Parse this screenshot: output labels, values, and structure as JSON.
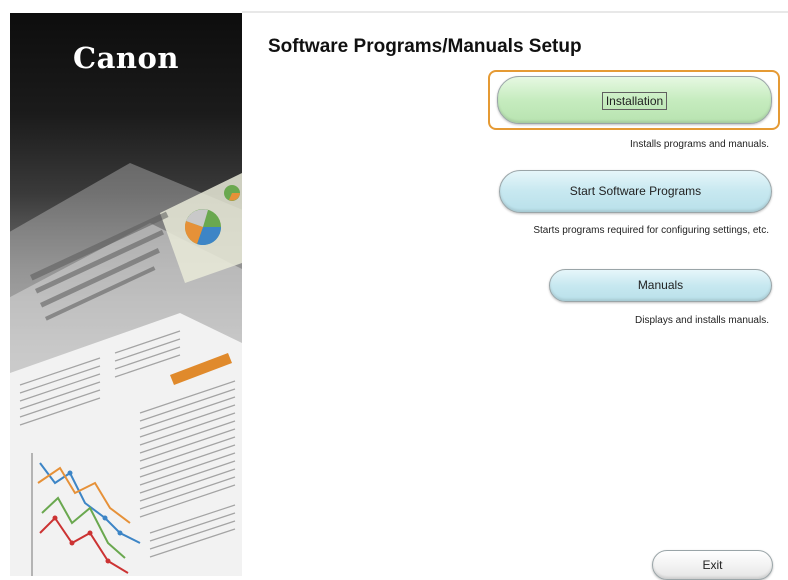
{
  "banner": {
    "logo_text": "Canon"
  },
  "setup": {
    "title": "Software Programs/Manuals Setup",
    "buttons": {
      "installation": {
        "label": "Installation",
        "description": "Installs programs and manuals."
      },
      "start_programs": {
        "label": "Start Software Programs",
        "description": "Starts programs required for configuring settings, etc."
      },
      "manuals": {
        "label": "Manuals",
        "description": "Displays and installs manuals."
      },
      "exit": {
        "label": "Exit"
      }
    }
  },
  "colors": {
    "focus_outline": "#e59a34",
    "install_button": "#c6ecbf",
    "start_button": "#c7e8f0",
    "manuals_button": "#c7e8f0"
  }
}
